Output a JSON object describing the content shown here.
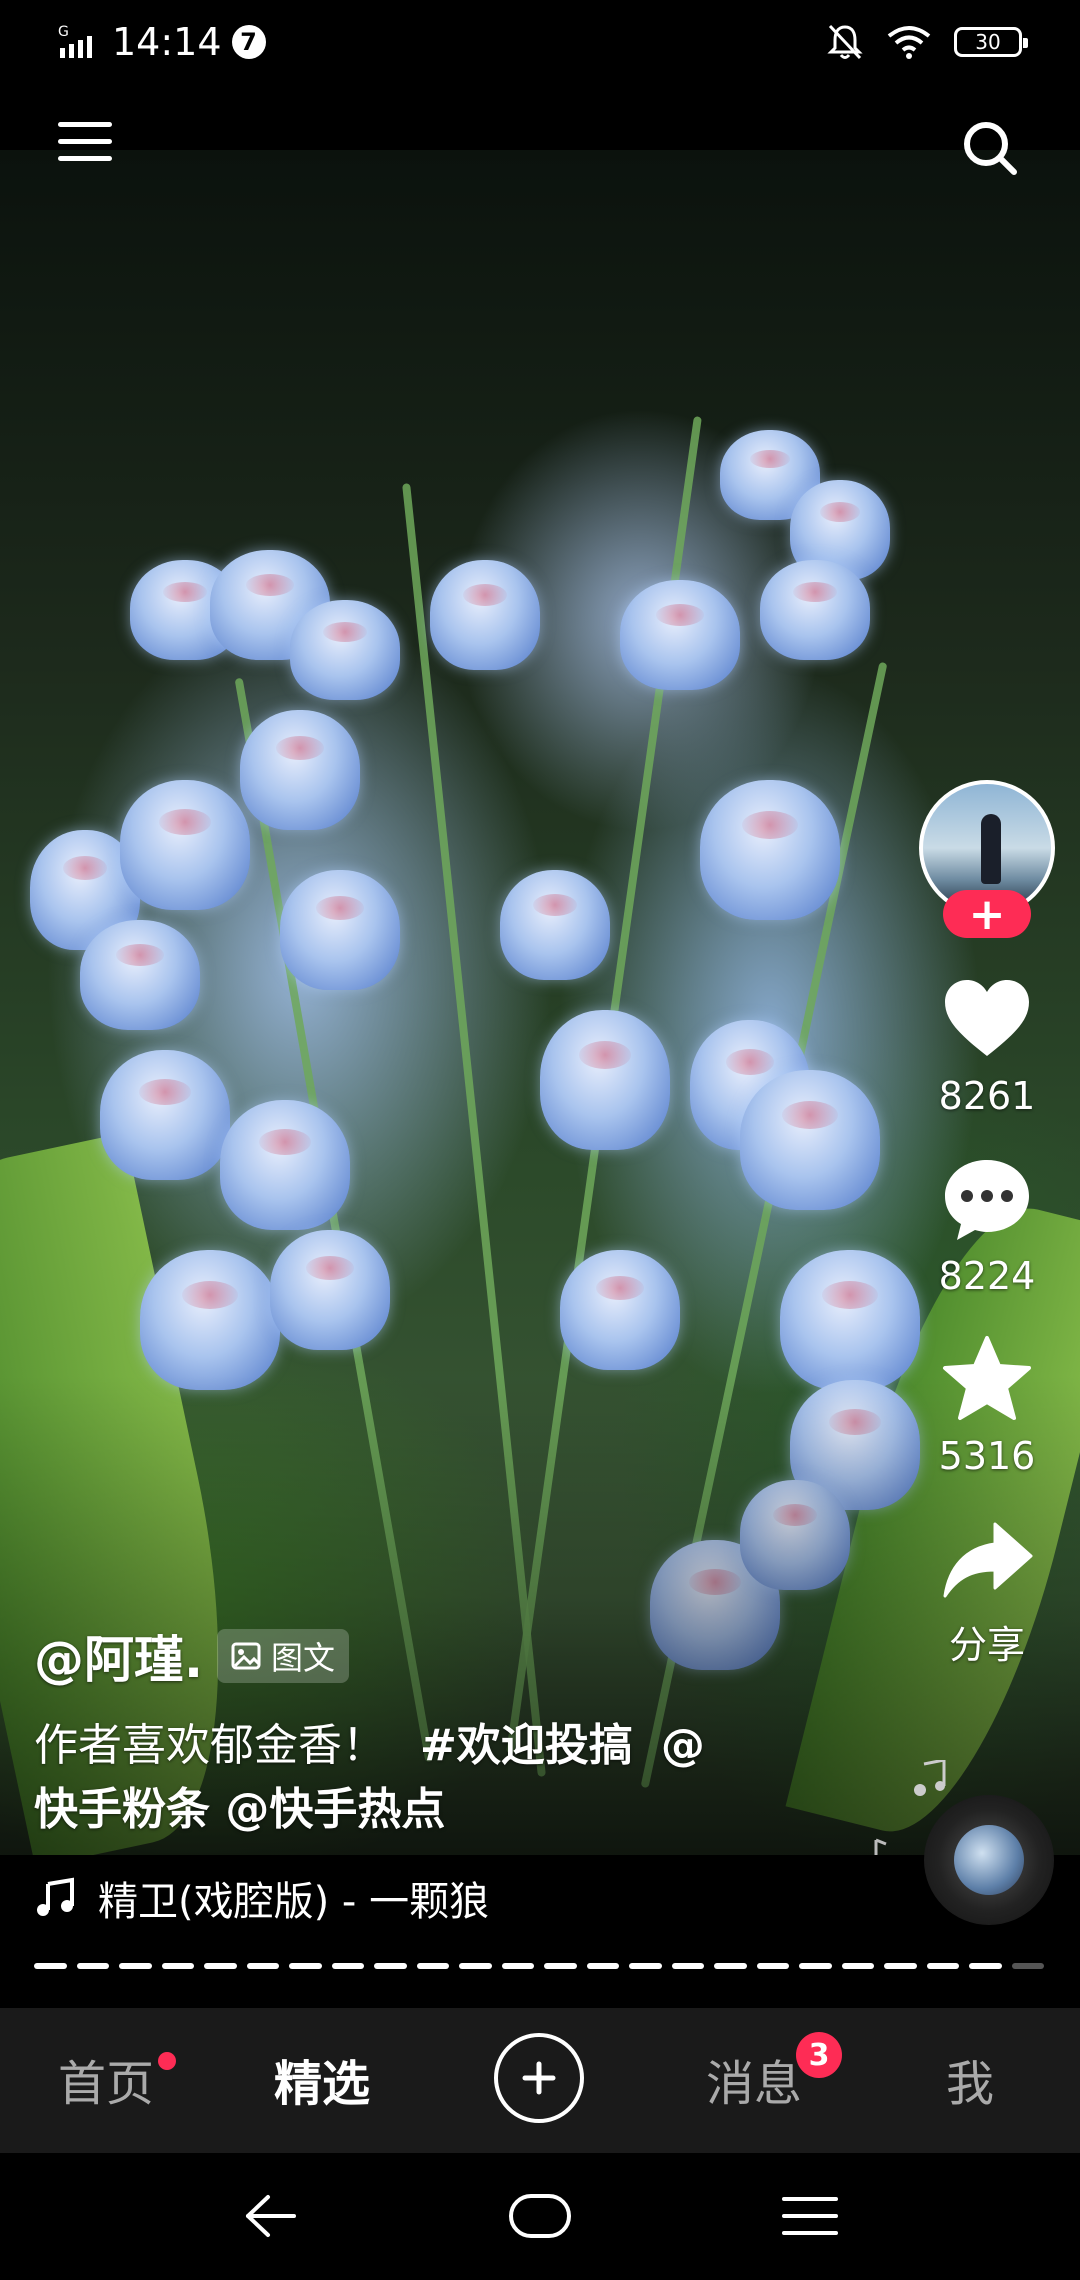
{
  "status_bar": {
    "network": "G",
    "time": "14:14",
    "notification_count": "7",
    "battery": "30"
  },
  "post": {
    "author": "@阿瑾.",
    "type_tag": "图文",
    "description_text": "作者喜欢郁金香！",
    "hashtag": "#欢迎投搞",
    "mentions_line1": "@",
    "mentions_line2": "快手粉条 @快手热点",
    "music": "精卫(戏腔版) - 一颗狼"
  },
  "actions": {
    "likes": "8261",
    "comments": "8224",
    "favorites": "5316",
    "share": "分享",
    "follow": "+"
  },
  "progress": {
    "total_segments": 24,
    "current_segment": 23
  },
  "bottom_nav": {
    "home": "首页",
    "featured": "精选",
    "create": "+",
    "messages": "消息",
    "messages_badge": "3",
    "me": "我"
  },
  "colors": {
    "accent": "#fe2c55",
    "nav_bg": "#1a1a1a"
  }
}
